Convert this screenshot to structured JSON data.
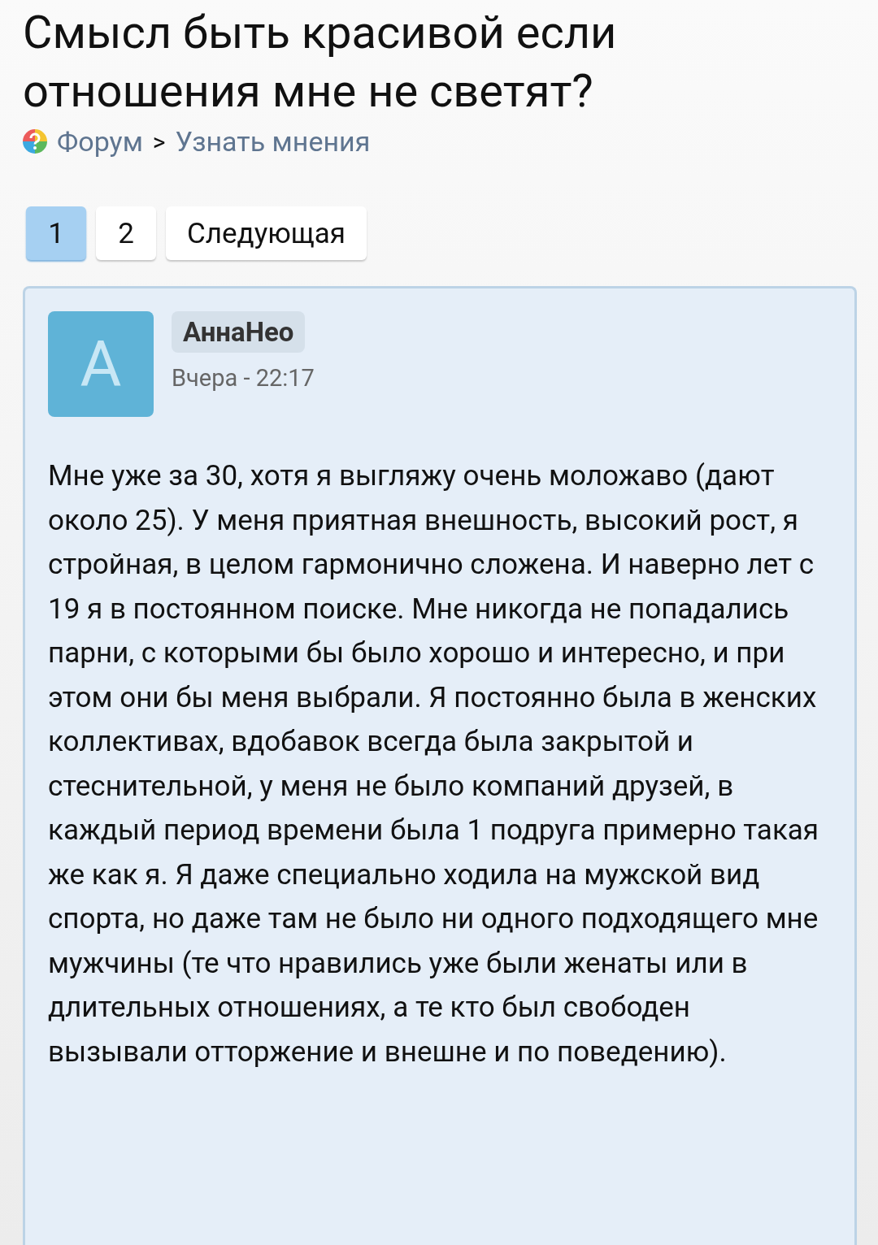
{
  "title": "Смысл быть красивой если отношения мне не светят?",
  "breadcrumb": {
    "items": [
      "Форум",
      "Узнать мнения"
    ],
    "separator": ">"
  },
  "pagination": [
    {
      "label": "1",
      "selected": true
    },
    {
      "label": "2",
      "selected": false
    },
    {
      "label": "Следующая",
      "selected": false
    }
  ],
  "post": {
    "avatar_letter": "А",
    "author": "АннаНео",
    "time": "Вчера - 22:17",
    "text": "Мне уже за 30, хотя я выгляжу очень моложаво (дают около 25). У меня приятная внешность, высокий рост, я стройная, в целом гармонично сложена. И наверно лет с 19 я в постоянном поиске. Мне никогда не попадались парни, с которыми бы было хорошо и интересно, и при этом они бы меня выбрали. Я постоянно была в женских коллективах, вдобавок всегда была закрытой и стеснительной, у меня не было компаний друзей, в каждый период времени была 1 подруга примерно такая же как я. Я даже специально ходила на мужской вид спорта, но даже там не было ни одного подходящего мне мужчины (те что нравились уже были женаты или в длительных отношениях, а те кто был свободен вызывали отторжение и внешне и по поведению)."
  }
}
